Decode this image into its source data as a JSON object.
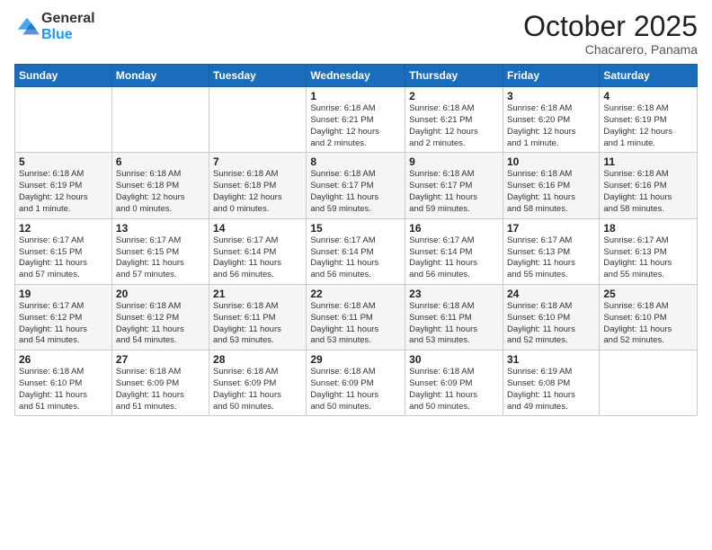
{
  "header": {
    "logo_general": "General",
    "logo_blue": "Blue",
    "month_title": "October 2025",
    "location": "Chacarero, Panama"
  },
  "weekdays": [
    "Sunday",
    "Monday",
    "Tuesday",
    "Wednesday",
    "Thursday",
    "Friday",
    "Saturday"
  ],
  "weeks": [
    [
      {
        "day": "",
        "info": ""
      },
      {
        "day": "",
        "info": ""
      },
      {
        "day": "",
        "info": ""
      },
      {
        "day": "1",
        "info": "Sunrise: 6:18 AM\nSunset: 6:21 PM\nDaylight: 12 hours\nand 2 minutes."
      },
      {
        "day": "2",
        "info": "Sunrise: 6:18 AM\nSunset: 6:21 PM\nDaylight: 12 hours\nand 2 minutes."
      },
      {
        "day": "3",
        "info": "Sunrise: 6:18 AM\nSunset: 6:20 PM\nDaylight: 12 hours\nand 1 minute."
      },
      {
        "day": "4",
        "info": "Sunrise: 6:18 AM\nSunset: 6:19 PM\nDaylight: 12 hours\nand 1 minute."
      }
    ],
    [
      {
        "day": "5",
        "info": "Sunrise: 6:18 AM\nSunset: 6:19 PM\nDaylight: 12 hours\nand 1 minute."
      },
      {
        "day": "6",
        "info": "Sunrise: 6:18 AM\nSunset: 6:18 PM\nDaylight: 12 hours\nand 0 minutes."
      },
      {
        "day": "7",
        "info": "Sunrise: 6:18 AM\nSunset: 6:18 PM\nDaylight: 12 hours\nand 0 minutes."
      },
      {
        "day": "8",
        "info": "Sunrise: 6:18 AM\nSunset: 6:17 PM\nDaylight: 11 hours\nand 59 minutes."
      },
      {
        "day": "9",
        "info": "Sunrise: 6:18 AM\nSunset: 6:17 PM\nDaylight: 11 hours\nand 59 minutes."
      },
      {
        "day": "10",
        "info": "Sunrise: 6:18 AM\nSunset: 6:16 PM\nDaylight: 11 hours\nand 58 minutes."
      },
      {
        "day": "11",
        "info": "Sunrise: 6:18 AM\nSunset: 6:16 PM\nDaylight: 11 hours\nand 58 minutes."
      }
    ],
    [
      {
        "day": "12",
        "info": "Sunrise: 6:17 AM\nSunset: 6:15 PM\nDaylight: 11 hours\nand 57 minutes."
      },
      {
        "day": "13",
        "info": "Sunrise: 6:17 AM\nSunset: 6:15 PM\nDaylight: 11 hours\nand 57 minutes."
      },
      {
        "day": "14",
        "info": "Sunrise: 6:17 AM\nSunset: 6:14 PM\nDaylight: 11 hours\nand 56 minutes."
      },
      {
        "day": "15",
        "info": "Sunrise: 6:17 AM\nSunset: 6:14 PM\nDaylight: 11 hours\nand 56 minutes."
      },
      {
        "day": "16",
        "info": "Sunrise: 6:17 AM\nSunset: 6:14 PM\nDaylight: 11 hours\nand 56 minutes."
      },
      {
        "day": "17",
        "info": "Sunrise: 6:17 AM\nSunset: 6:13 PM\nDaylight: 11 hours\nand 55 minutes."
      },
      {
        "day": "18",
        "info": "Sunrise: 6:17 AM\nSunset: 6:13 PM\nDaylight: 11 hours\nand 55 minutes."
      }
    ],
    [
      {
        "day": "19",
        "info": "Sunrise: 6:17 AM\nSunset: 6:12 PM\nDaylight: 11 hours\nand 54 minutes."
      },
      {
        "day": "20",
        "info": "Sunrise: 6:18 AM\nSunset: 6:12 PM\nDaylight: 11 hours\nand 54 minutes."
      },
      {
        "day": "21",
        "info": "Sunrise: 6:18 AM\nSunset: 6:11 PM\nDaylight: 11 hours\nand 53 minutes."
      },
      {
        "day": "22",
        "info": "Sunrise: 6:18 AM\nSunset: 6:11 PM\nDaylight: 11 hours\nand 53 minutes."
      },
      {
        "day": "23",
        "info": "Sunrise: 6:18 AM\nSunset: 6:11 PM\nDaylight: 11 hours\nand 53 minutes."
      },
      {
        "day": "24",
        "info": "Sunrise: 6:18 AM\nSunset: 6:10 PM\nDaylight: 11 hours\nand 52 minutes."
      },
      {
        "day": "25",
        "info": "Sunrise: 6:18 AM\nSunset: 6:10 PM\nDaylight: 11 hours\nand 52 minutes."
      }
    ],
    [
      {
        "day": "26",
        "info": "Sunrise: 6:18 AM\nSunset: 6:10 PM\nDaylight: 11 hours\nand 51 minutes."
      },
      {
        "day": "27",
        "info": "Sunrise: 6:18 AM\nSunset: 6:09 PM\nDaylight: 11 hours\nand 51 minutes."
      },
      {
        "day": "28",
        "info": "Sunrise: 6:18 AM\nSunset: 6:09 PM\nDaylight: 11 hours\nand 50 minutes."
      },
      {
        "day": "29",
        "info": "Sunrise: 6:18 AM\nSunset: 6:09 PM\nDaylight: 11 hours\nand 50 minutes."
      },
      {
        "day": "30",
        "info": "Sunrise: 6:18 AM\nSunset: 6:09 PM\nDaylight: 11 hours\nand 50 minutes."
      },
      {
        "day": "31",
        "info": "Sunrise: 6:19 AM\nSunset: 6:08 PM\nDaylight: 11 hours\nand 49 minutes."
      },
      {
        "day": "",
        "info": ""
      }
    ]
  ]
}
